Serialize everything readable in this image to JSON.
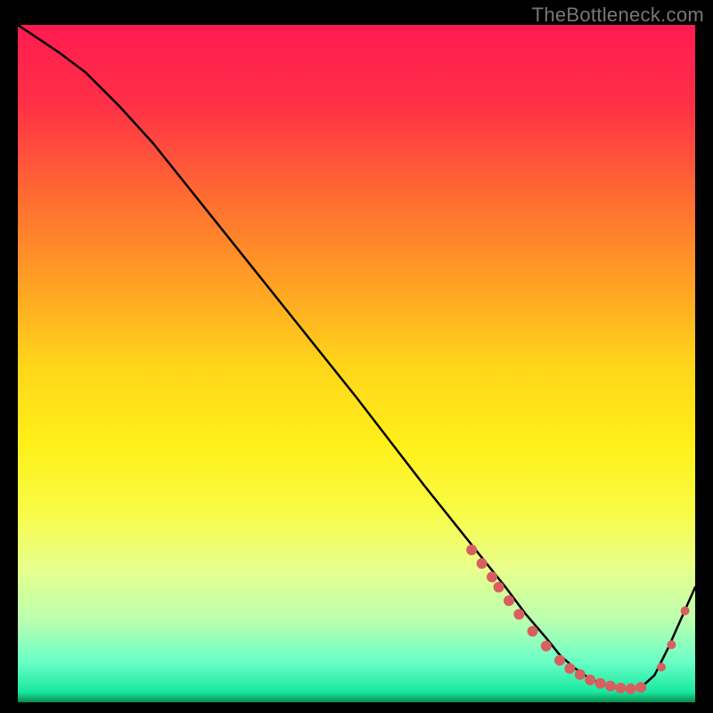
{
  "watermark": "TheBottleneck.com",
  "chart_data": {
    "type": "line",
    "title": "",
    "xlabel": "",
    "ylabel": "",
    "xlim": [
      0,
      100
    ],
    "ylim": [
      0,
      100
    ],
    "series": [
      {
        "name": "curve",
        "x": [
          0,
          3,
          6,
          10,
          15,
          20,
          30,
          40,
          50,
          60,
          68,
          72,
          75,
          78,
          80,
          82,
          84,
          86,
          88,
          90,
          92,
          94,
          96,
          100
        ],
        "y": [
          100,
          98,
          96,
          93,
          88,
          82.5,
          70,
          57.5,
          45,
          32,
          22,
          17,
          13,
          9.5,
          7,
          5.2,
          3.8,
          2.8,
          2.2,
          2,
          2.2,
          4,
          8,
          17
        ],
        "color": "#000000"
      }
    ],
    "points": {
      "name": "markers",
      "color": "#d85f5f",
      "radius_main": 6,
      "radius_small": 5,
      "x": [
        67,
        68.5,
        70,
        71,
        72.5,
        74,
        76,
        78,
        80,
        81.5,
        83,
        84.5,
        86,
        87.5,
        89,
        90.5,
        92,
        95,
        96.5,
        98.5
      ],
      "y": [
        22.5,
        20.5,
        18.5,
        17,
        15,
        13,
        10.5,
        8.3,
        6.2,
        5,
        4.1,
        3.3,
        2.8,
        2.4,
        2.1,
        2,
        2.2,
        5.2,
        8.5,
        13.5
      ],
      "radius_idx_small": [
        17,
        18,
        19
      ]
    },
    "gradient_stops": [
      {
        "offset": 0.0,
        "color": "#ff1a51"
      },
      {
        "offset": 0.12,
        "color": "#ff3146"
      },
      {
        "offset": 0.25,
        "color": "#ff6a32"
      },
      {
        "offset": 0.38,
        "color": "#ffa024"
      },
      {
        "offset": 0.5,
        "color": "#ffd41a"
      },
      {
        "offset": 0.62,
        "color": "#fff019"
      },
      {
        "offset": 0.72,
        "color": "#f8fb47"
      },
      {
        "offset": 0.8,
        "color": "#e8ff8a"
      },
      {
        "offset": 0.88,
        "color": "#b9ffb0"
      },
      {
        "offset": 0.94,
        "color": "#6affc6"
      },
      {
        "offset": 0.985,
        "color": "#18e8a0"
      },
      {
        "offset": 1.0,
        "color": "#0a8a4a"
      }
    ]
  }
}
